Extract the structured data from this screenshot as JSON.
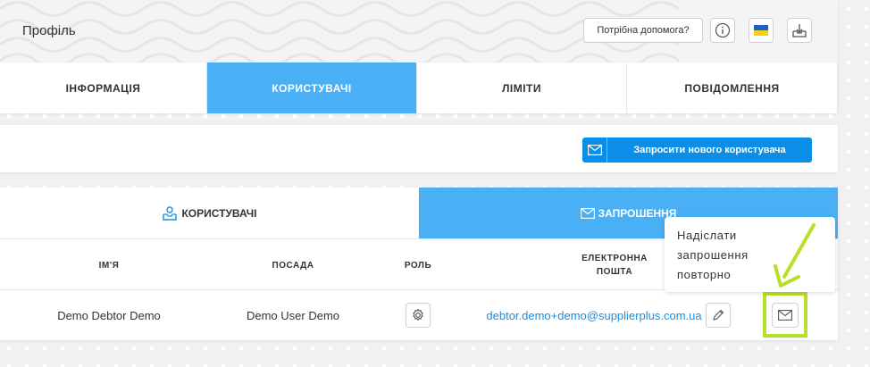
{
  "header": {
    "title": "Профіль",
    "help_label": "Потрібна допомога?",
    "icons": [
      "info-icon",
      "ukraine-flag-icon",
      "download-icon"
    ]
  },
  "main_tabs": [
    {
      "label": "ІНФОРМАЦІЯ",
      "active": false
    },
    {
      "label": "КОРИСТУВАЧІ",
      "active": true
    },
    {
      "label": "ЛІМІТИ",
      "active": false
    },
    {
      "label": "ПОВІДОМЛЕННЯ",
      "active": false
    }
  ],
  "invite": {
    "button_label": "Запросити нового користувача",
    "icon": "envelope-icon"
  },
  "sub_tabs": [
    {
      "label": "КОРИСТУВАЧІ",
      "icon": "user-inbox-icon",
      "active": false
    },
    {
      "label": "ЗАПРОШЕННЯ",
      "icon": "envelope-icon",
      "active": true
    }
  ],
  "table": {
    "columns": [
      "ІМ'Я",
      "ПОСАДА",
      "РОЛЬ",
      "ЕЛЕКТРОННА ПОШТА"
    ],
    "email_header_line1": "ЕЛЕКТРОННА",
    "email_header_line2": "ПОШТА",
    "rows": [
      {
        "name": "Demo Debtor Demo",
        "position": "Demo User Demo",
        "role_icon": "gear-icon",
        "email": "debtor.demo+demo@supplierplus.com.ua"
      }
    ]
  },
  "tooltip": {
    "line1": "Надіслати",
    "line2": "запрошення",
    "line3": "повторно"
  },
  "colors": {
    "accent": "#4ab0f5",
    "button": "#0a8ee8",
    "highlight": "#b6e02a",
    "link": "#1a8ee0"
  }
}
